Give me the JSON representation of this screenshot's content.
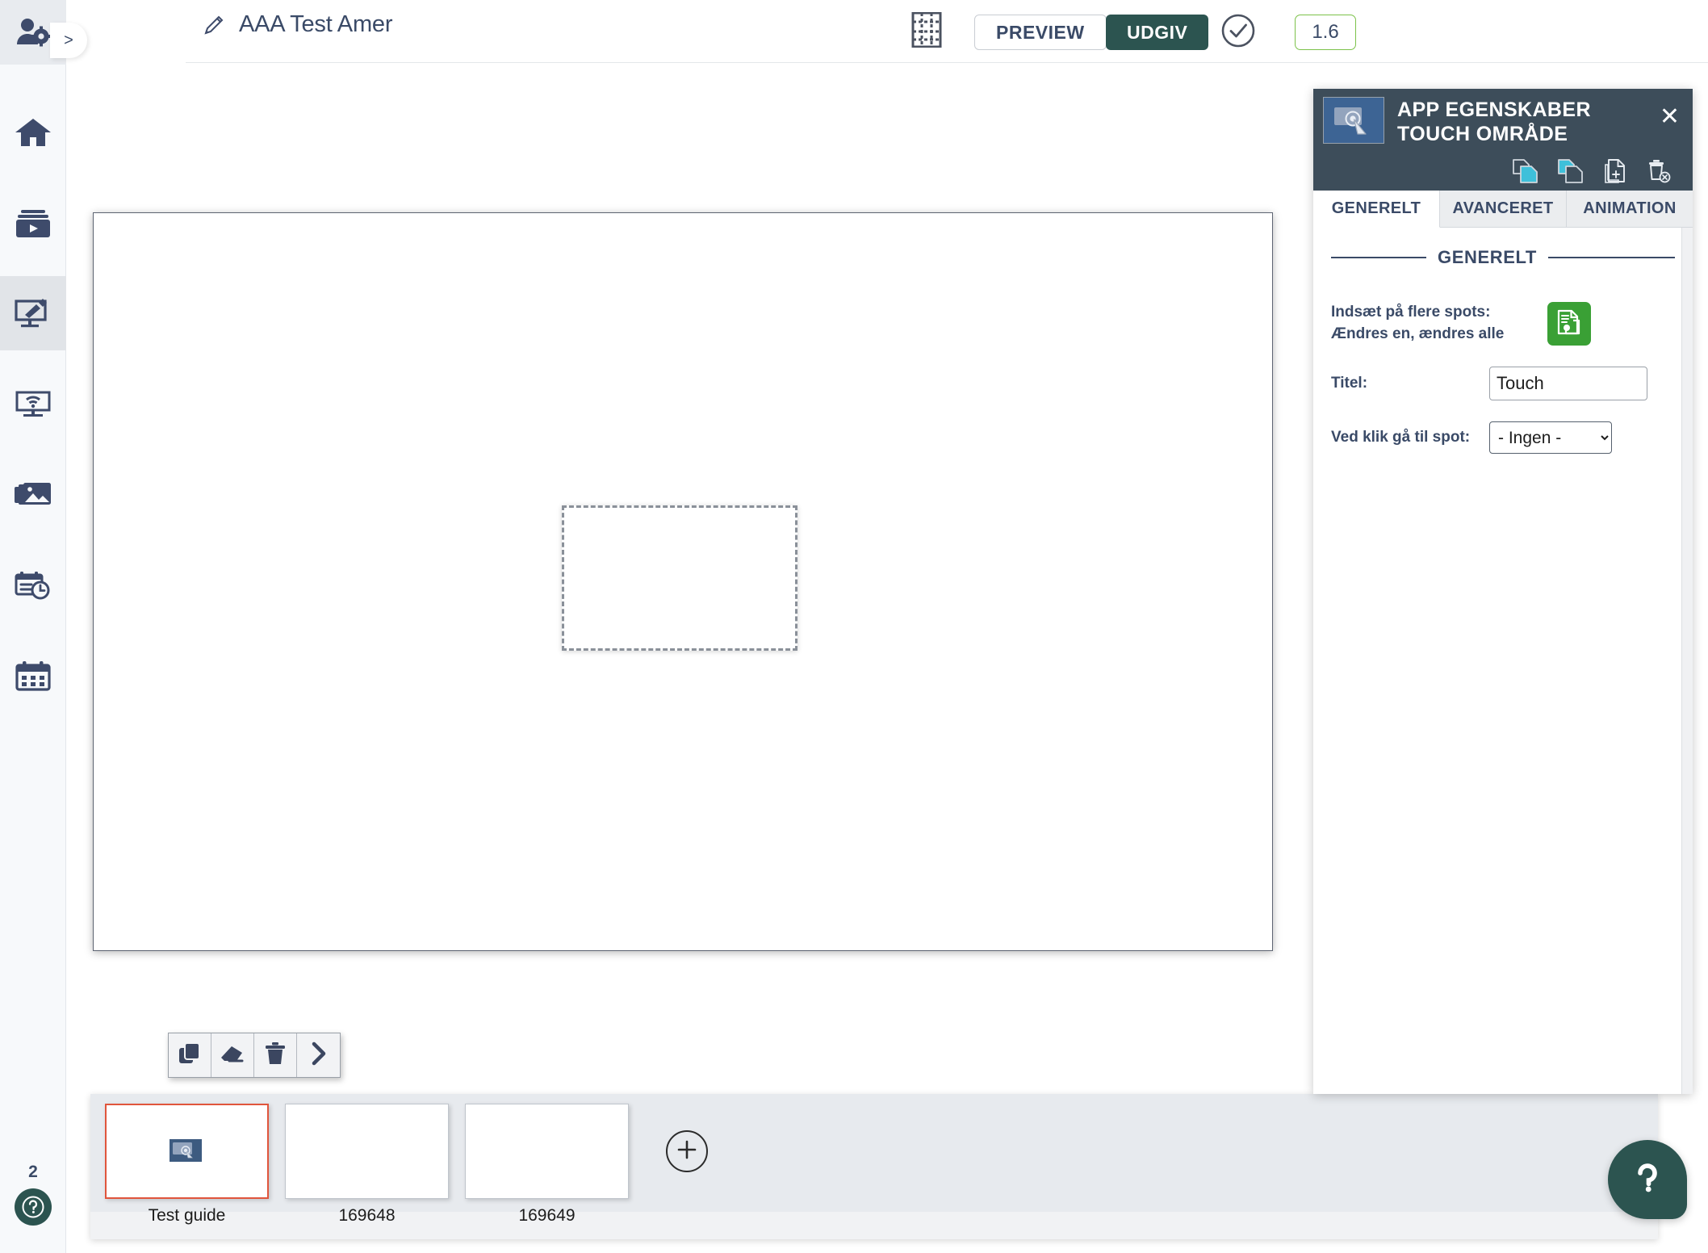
{
  "sidebar": {
    "user_settings_icon": "user-gear-icon",
    "expand_label": ">",
    "items": [
      {
        "icon": "home-icon",
        "name": "home"
      },
      {
        "icon": "media-play-icon",
        "name": "media"
      },
      {
        "icon": "screen-edit-icon",
        "name": "editor",
        "active": true
      },
      {
        "icon": "screen-wifi-icon",
        "name": "screens"
      },
      {
        "icon": "images-icon",
        "name": "gallery"
      },
      {
        "icon": "schedule-clock-icon",
        "name": "schedule"
      },
      {
        "icon": "calendar-icon",
        "name": "calendar"
      }
    ],
    "page_number": "2",
    "help_icon": "question-mark-icon"
  },
  "topbar": {
    "edit_icon": "pencil-icon",
    "document_title": "AAA Test Amer",
    "grid_icon": "grid-icon",
    "preview_label": "PREVIEW",
    "publish_label": "UDGIV",
    "check_icon": "check-circle-icon",
    "version": "1.6",
    "accent_publish": "#2c5450",
    "accent_version_border": "#7cc24a"
  },
  "canvas": {
    "touch_area_name": "touch-area-selection"
  },
  "mini_toolbar": {
    "buttons": [
      {
        "icon": "duplicate-icon",
        "name": "duplicate"
      },
      {
        "icon": "eraser-icon",
        "name": "clear"
      },
      {
        "icon": "trash-icon",
        "name": "delete"
      },
      {
        "icon": "chevron-right-icon",
        "name": "next"
      }
    ]
  },
  "thumbnails": {
    "items": [
      {
        "label": "Test guide",
        "selected": true,
        "has_object": true
      },
      {
        "label": "169648",
        "selected": false,
        "has_object": false
      },
      {
        "label": "169649",
        "selected": false,
        "has_object": false
      }
    ],
    "add_icon": "plus-circle-icon",
    "selected_border_color": "#e0553c"
  },
  "help_fab": {
    "icon": "question-mark-icon",
    "color": "#2c5450"
  },
  "properties_panel": {
    "icon": "touch-screen-icon",
    "title_line1": "APP EGENSKABER",
    "title_line2": "TOUCH OMRÅDE",
    "close_label": "✕",
    "toolbar_icons": [
      {
        "icon": "copy-icon",
        "name": "copy"
      },
      {
        "icon": "paste-icon",
        "name": "paste"
      },
      {
        "icon": "add-page-icon",
        "name": "add-page"
      },
      {
        "icon": "delete-page-icon",
        "name": "delete-page"
      }
    ],
    "tabs": [
      {
        "label": "GENERELT",
        "active": true
      },
      {
        "label": "AVANCERET",
        "active": false
      },
      {
        "label": "ANIMATION",
        "active": false
      }
    ],
    "section_title": "GENERELT",
    "multi_spot_label_line1": "Indsæt på flere spots:",
    "multi_spot_label_line2": "Ændres en, ændres alle",
    "multi_spot_button_icon": "multi-document-icon",
    "multi_spot_button_color": "#3aa035",
    "title_field_label": "Titel:",
    "title_field_value": "Touch",
    "title_field_placeholder": "Titel",
    "goto_spot_label": "Ved klik gå til spot:",
    "goto_spot_value": "- Ingen -",
    "goto_spot_options": [
      "- Ingen -"
    ]
  }
}
